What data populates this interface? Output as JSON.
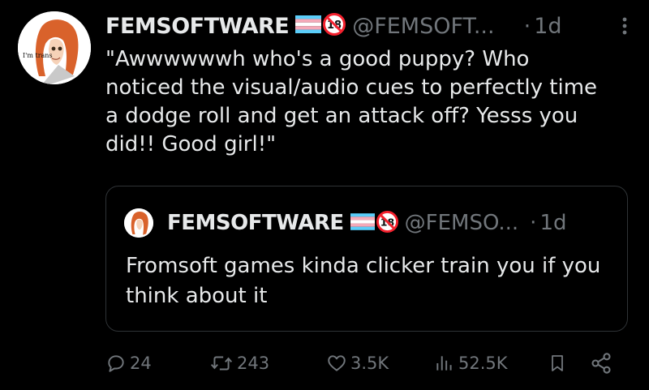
{
  "tweet": {
    "display_name": "FEMSOFTWARE",
    "handle": "@FEMSOFT...",
    "time_sep": "·",
    "time": "1d",
    "age_badge": "18",
    "avatar_text": "I'm trans",
    "text": "\"Awwwwwwh who's a good puppy? Who noticed the visual/audio cues to perfectly time a dodge roll and get an attack off? Yesss you did!! Good girl!\"",
    "more_icon": "more-vertical-icon"
  },
  "quoted": {
    "display_name": "FEMSOFTWARE",
    "handle": "@FEMSO...",
    "time_sep": "·",
    "time": "1d",
    "age_badge": "18",
    "text": "Fromsoft games kinda clicker train you if you think about it"
  },
  "actions": {
    "reply_count": "24",
    "retweet_count": "243",
    "like_count": "3.5K",
    "views_count": "52.5K"
  },
  "colors": {
    "background": "#000000",
    "text": "#e7e9ea",
    "muted": "#71767b",
    "border": "#2f3336",
    "trans_blue": "#5BCEFA",
    "trans_pink": "#F5A9B8",
    "badge_red": "#f4212e"
  }
}
